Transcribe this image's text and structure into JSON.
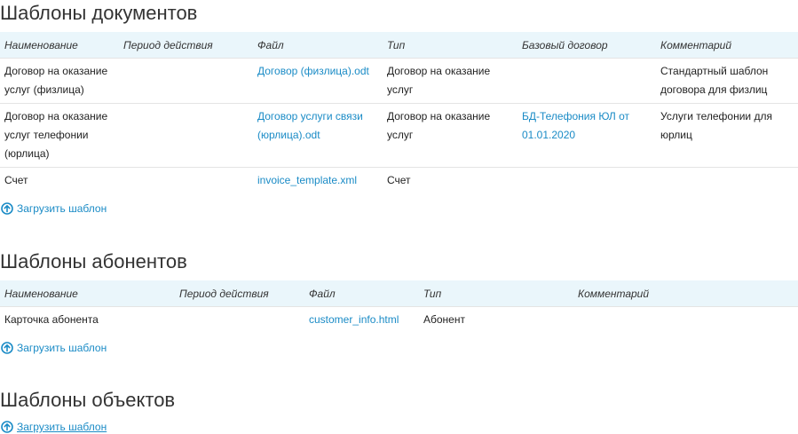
{
  "documents": {
    "title": "Шаблоны документов",
    "headers": [
      "Наименование",
      "Период действия",
      "Файл",
      "Тип",
      "Базовый договор",
      "Комментарий"
    ],
    "rows": [
      {
        "name": "Договор на оказание услуг (физлица)",
        "period": "",
        "file": "Договор (физлица).odt",
        "type": "Договор на оказание услуг",
        "base": "",
        "comment": "Стандартный шаблон договора для физлиц"
      },
      {
        "name": "Договор на оказание услуг телефонии (юрлица)",
        "period": "",
        "file": "Договор услуги связи (юрлица).odt",
        "type": "Договор на оказание услуг",
        "base": "БД-Телефония ЮЛ от 01.01.2020",
        "comment": "Услуги телефонии для юрлиц"
      },
      {
        "name": "Счет",
        "period": "",
        "file": "invoice_template.xml",
        "type": "Счет",
        "base": "",
        "comment": ""
      }
    ],
    "upload_label": "Загрузить шаблон"
  },
  "subscribers": {
    "title": "Шаблоны абонентов",
    "headers": [
      "Наименование",
      "Период действия",
      "Файл",
      "Тип",
      "Комментарий"
    ],
    "rows": [
      {
        "name": "Карточка абонента",
        "period": "",
        "file": "customer_info.html",
        "type": "Абонент",
        "comment": ""
      }
    ],
    "upload_label": "Загрузить шаблон"
  },
  "objects": {
    "title": "Шаблоны объектов",
    "upload_label": "Загрузить шаблон"
  },
  "colors": {
    "link": "#1a8bc6",
    "header_bg": "#eaf6fb"
  },
  "icons": {
    "upload": "upload-arrow-circle-icon"
  }
}
